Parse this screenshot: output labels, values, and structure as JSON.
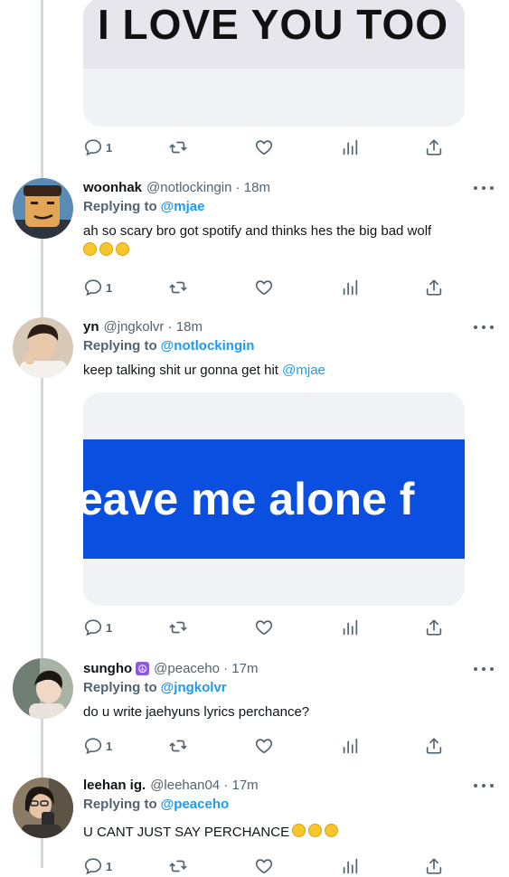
{
  "media": {
    "first_image_text": "I LOVE YOU TOO",
    "second_image_text": "eave me alone f"
  },
  "tweets": [
    {
      "name": "woonhak",
      "handle": "@notlockingin · 18m",
      "replying_label": "Replying to",
      "replying_to": "@mjae",
      "text": "ah so scary bro got spotify and thinks hes the big bad wolf",
      "emoji_count": 3,
      "reply_count": "1"
    },
    {
      "name": "yn",
      "handle": "@jngkolvr · 18m",
      "replying_label": "Replying to",
      "replying_to": "@notlockingin",
      "text": "keep talking shit ur gonna get hit",
      "text_mention": "@mjae",
      "reply_count": "1"
    },
    {
      "name": "sungho",
      "name_badge": "☮",
      "handle": "@peaceho · 17m",
      "replying_label": "Replying to",
      "replying_to": "@jngkolvr",
      "text": "do u write jaehyuns lyrics perchance?",
      "reply_count": "1"
    },
    {
      "name": "leehan ig.",
      "handle": "@leehan04 · 17m",
      "replying_label": "Replying to",
      "replying_to": "@peaceho",
      "text": "U CANT JUST SAY PERCHANCE",
      "emoji_count": 3,
      "reply_count": "1"
    }
  ],
  "top_actions": {
    "reply_count": "1"
  },
  "icons": [
    "reply-icon",
    "retweet-icon",
    "like-icon",
    "views-icon",
    "share-icon",
    "more-icon"
  ],
  "colors": {
    "link": "#1d9bf0",
    "secondary": "#536471",
    "thread_line": "#cfd9de",
    "image_blue": "#0a4fe0"
  }
}
